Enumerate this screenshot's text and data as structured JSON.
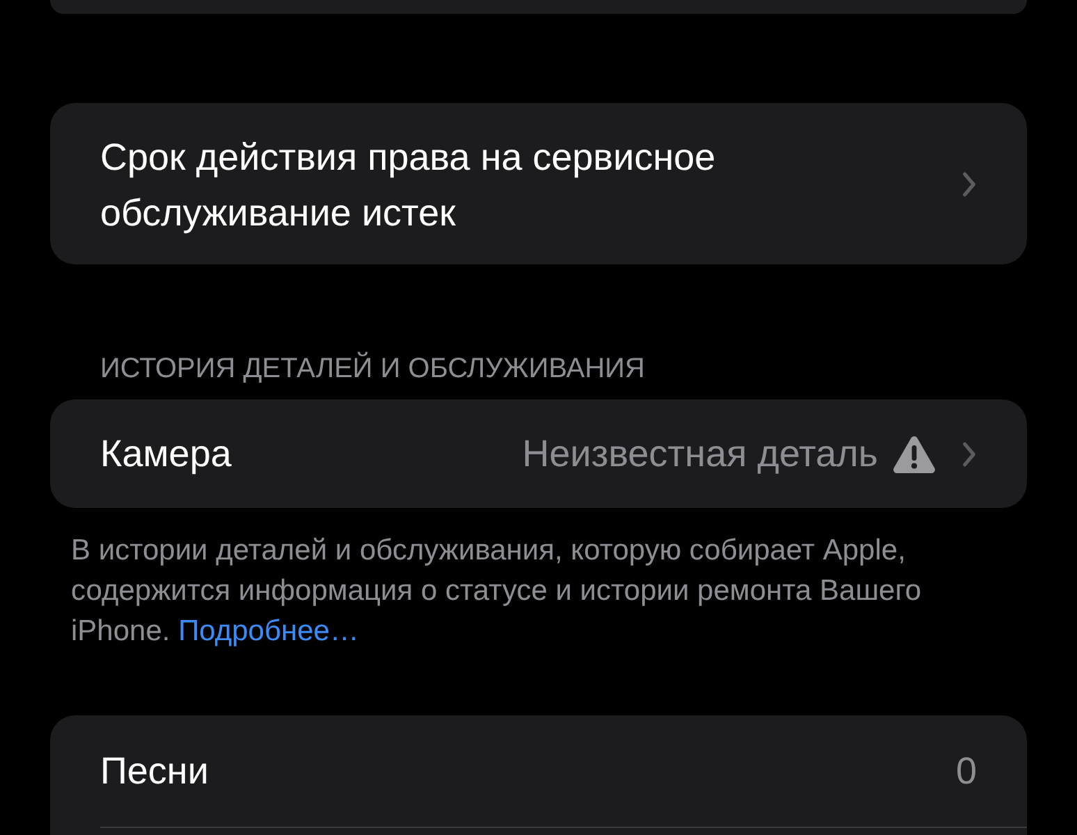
{
  "service_entitlement": {
    "label": "Срок действия права на сервисное обслуживание истек"
  },
  "parts_history": {
    "header": "ИСТОРИЯ ДЕТАЛЕЙ И ОБСЛУЖИВАНИЯ",
    "rows": [
      {
        "label": "Камера",
        "value": "Неизвестная деталь",
        "warning": true
      }
    ],
    "footer": {
      "text": "В истории деталей и обслуживания, которую собирает Apple, содержится информация о статусе и истории ремонта Вашего iPhone.",
      "link": "Подробнее…"
    }
  },
  "media": {
    "rows": [
      {
        "label": "Песни",
        "value": "0"
      }
    ]
  }
}
